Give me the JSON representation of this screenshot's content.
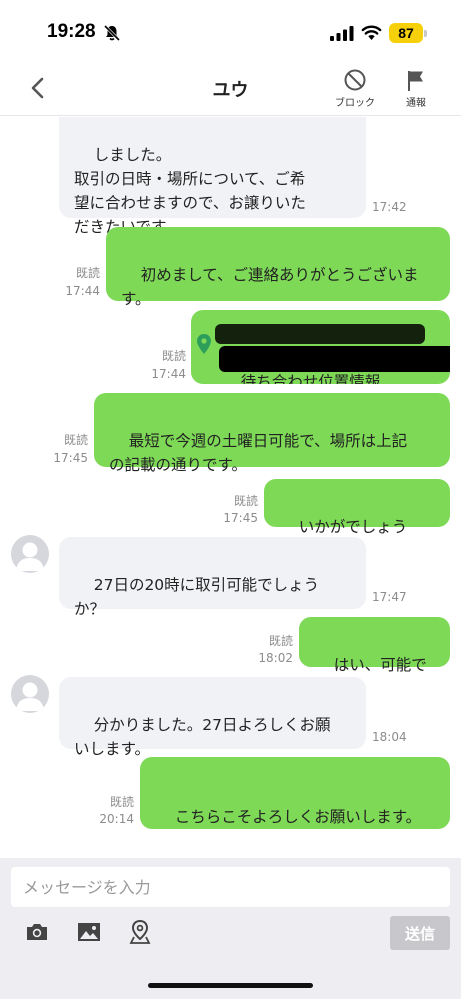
{
  "status_bar": {
    "time": "19:28",
    "battery": "87",
    "battery_color": "#f5d00b"
  },
  "header": {
    "title": "ユウ",
    "block_label": "ブロック",
    "report_label": "通報"
  },
  "messages": [
    {
      "side": "in",
      "text": "しました。\n取引の日時・場所について、ご希\n望に合わせますので、お譲りいた\nだきたいです。",
      "time": "17:42"
    },
    {
      "side": "out",
      "text": "初めまして、ご連絡ありがとうございま\nす。",
      "read": "既読",
      "time": "17:44"
    },
    {
      "side": "out",
      "text": "待ち合わせ位置情報\n東京都中央区月島3丁目10-4",
      "read": "既読",
      "time": "17:44"
    },
    {
      "side": "out",
      "text": "最短で今週の土曜日可能で、場所は上記\nの記載の通りです。",
      "read": "既読",
      "time": "17:45"
    },
    {
      "side": "out",
      "text": "いかがでしょうか？",
      "read": "既読",
      "time": "17:45"
    },
    {
      "side": "in",
      "text": "27日の20時に取引可能でしょう\nか？",
      "time": "17:47"
    },
    {
      "side": "out",
      "text": "はい、可能です",
      "read": "既読",
      "time": "18:02"
    },
    {
      "side": "in",
      "text": "分かりました。27日よろしくお願\nいします。",
      "time": "18:04"
    },
    {
      "side": "out",
      "text": "こちらこそよろしくお願いします。",
      "read": "既読",
      "time": "20:14"
    }
  ],
  "composer": {
    "placeholder": "メッセージを入力",
    "send_label": "送信"
  },
  "colors": {
    "outgoing": "#7ed957",
    "incoming": "#f1f2f6",
    "location_pin": "#2e9e5b"
  }
}
